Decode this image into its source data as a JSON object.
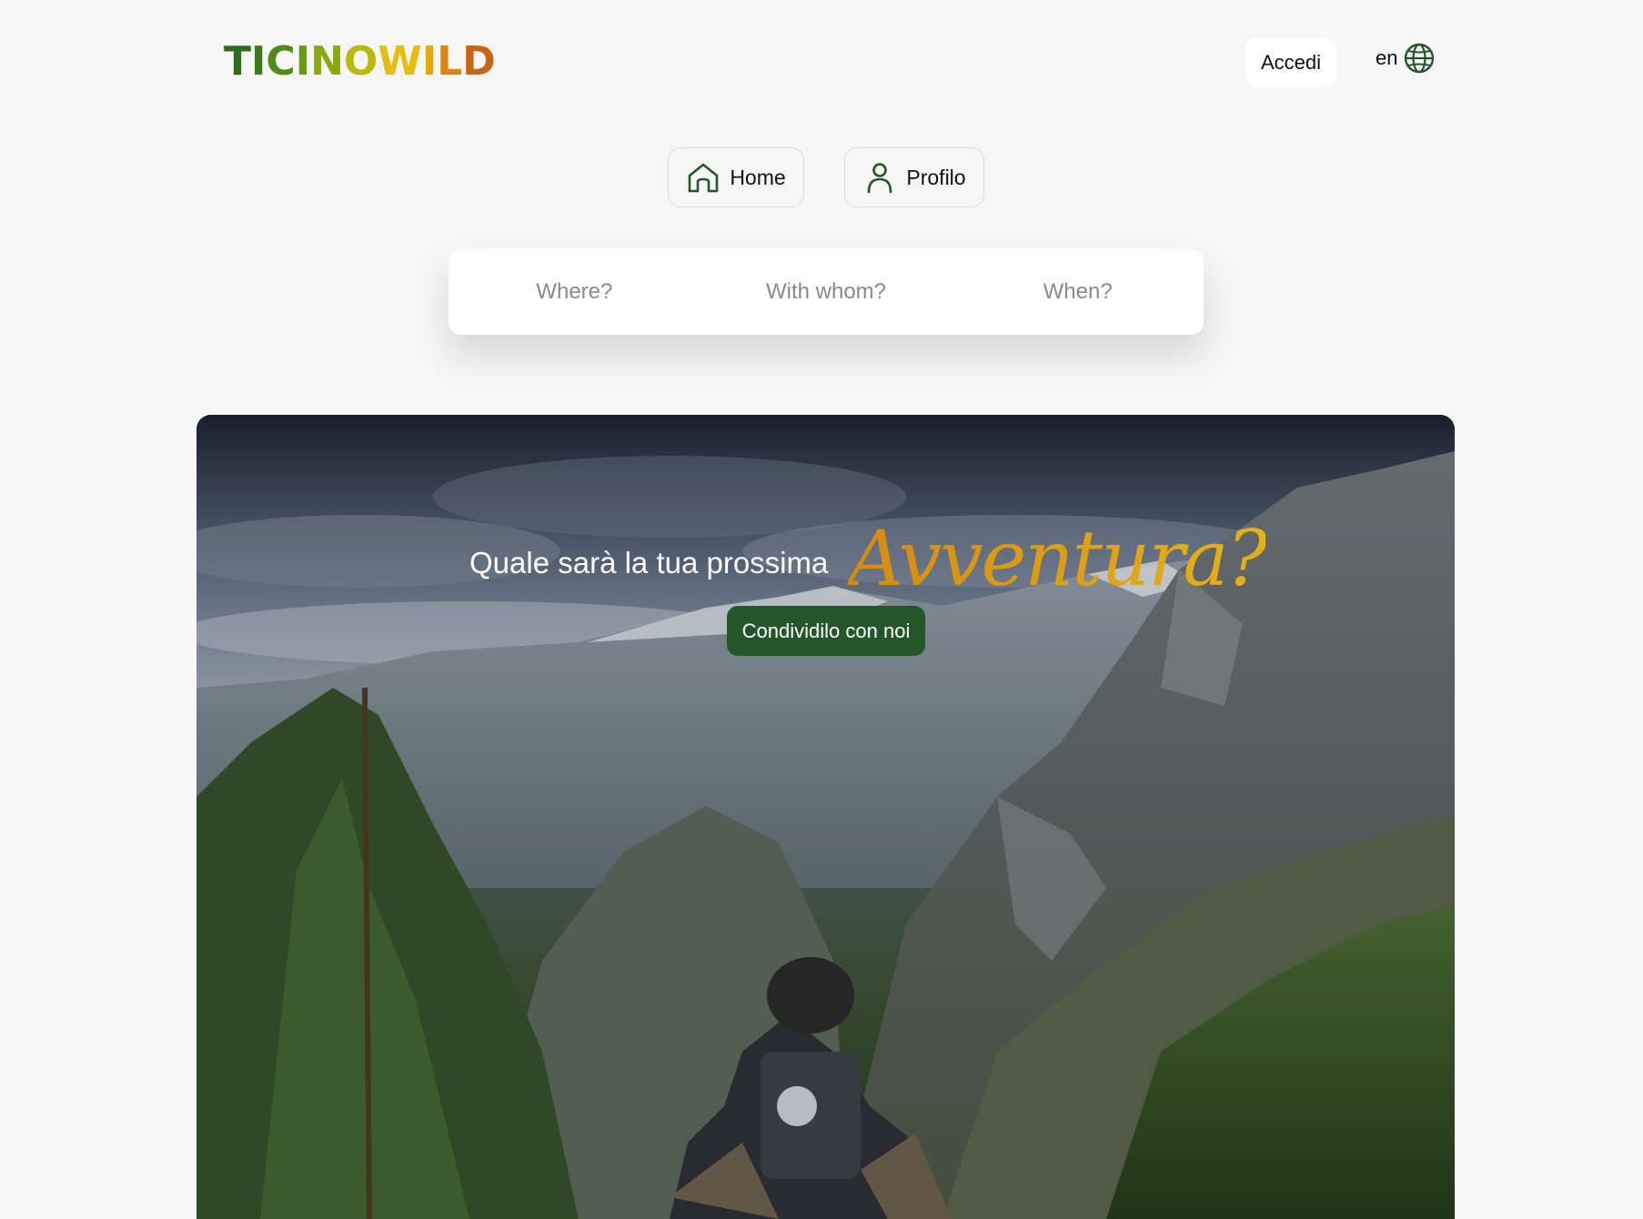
{
  "header": {
    "logo_letters": [
      {
        "ch": "T",
        "color": "#2f6a1e"
      },
      {
        "ch": "I",
        "color": "#3d7a1c"
      },
      {
        "ch": "C",
        "color": "#4f8a1a"
      },
      {
        "ch": "I",
        "color": "#6a9a16"
      },
      {
        "ch": "N",
        "color": "#8aa812"
      },
      {
        "ch": "O",
        "color": "#b9b90f"
      },
      {
        "ch": "W",
        "color": "#e6bd0e"
      },
      {
        "ch": "I",
        "color": "#e8a50e"
      },
      {
        "ch": "L",
        "color": "#dd8410"
      },
      {
        "ch": "D",
        "color": "#c76712"
      }
    ],
    "login_label": "Accedi",
    "language": "en"
  },
  "nav": {
    "home_label": "Home",
    "profile_label": "Profilo"
  },
  "search": {
    "where": "Where?",
    "with_whom": "With whom?",
    "when": "When?"
  },
  "hero": {
    "question": "Quale sarà la tua prossima",
    "highlight": "Avventura?",
    "cta_label": "Condividilo con noi"
  },
  "colors": {
    "brand_green": "#24562a",
    "accent_orange": "#d58a12",
    "page_bg": "#f6f6f6"
  }
}
